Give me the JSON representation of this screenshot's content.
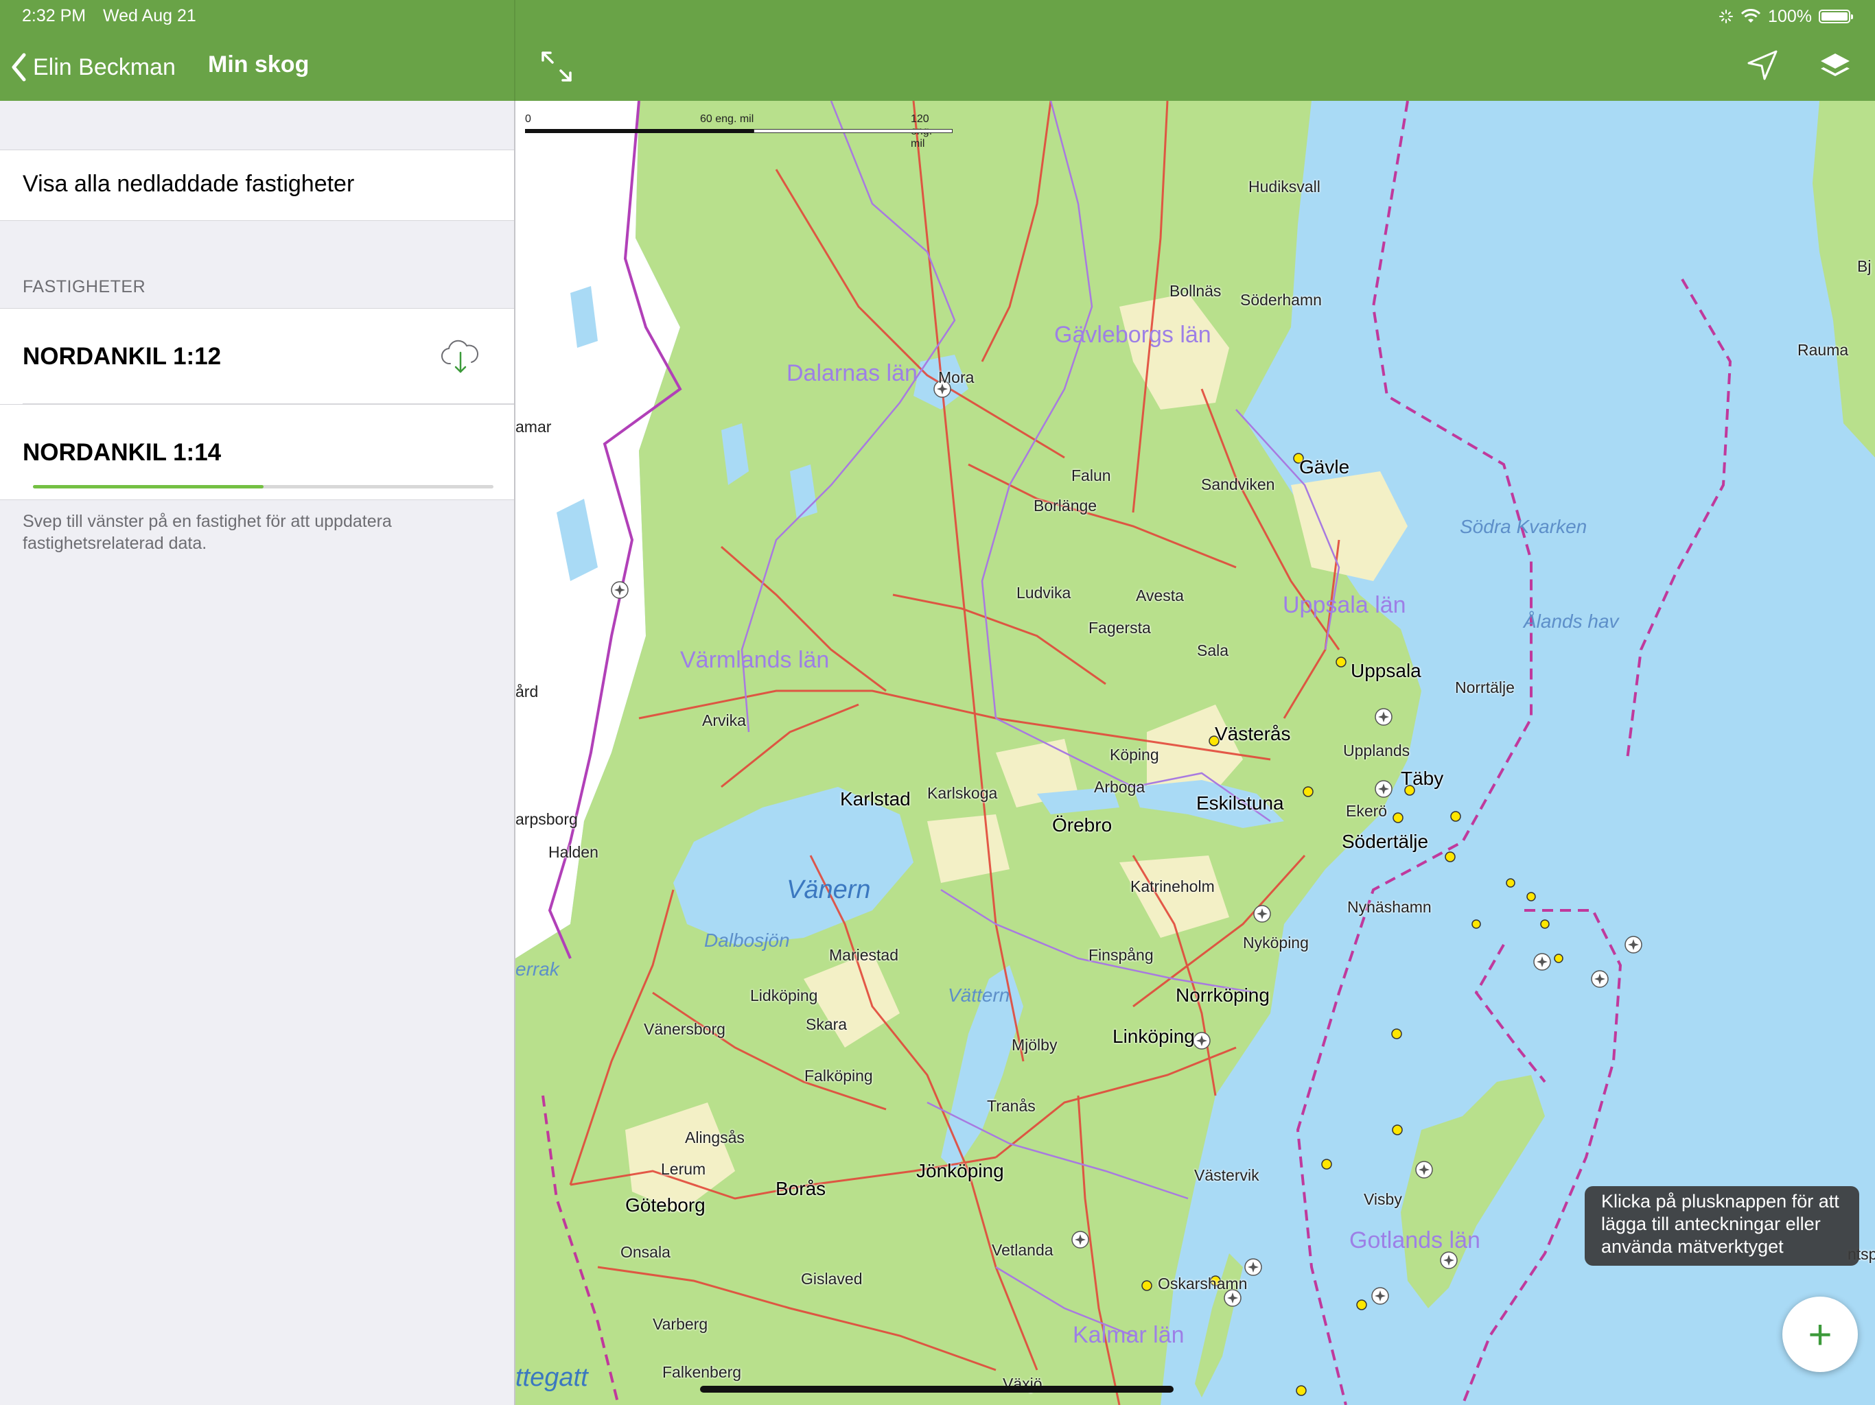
{
  "status_bar": {
    "time": "2:32 PM",
    "date": "Wed Aug 21",
    "battery": "100%"
  },
  "nav": {
    "back_label": "Elin Beckman",
    "title": "Min skog"
  },
  "sidebar": {
    "show_all_label": "Visa alla nedladdade fastigheter",
    "section_header": "FASTIGHETER",
    "properties": [
      {
        "name": "NORDANKIL 1:12",
        "status": "download-cloud-icon"
      },
      {
        "name": "NORDANKIL 1:14",
        "download_progress": 0.5
      }
    ],
    "footer_note": "Svep till vänster på en fastighet för att uppdatera fastighetsrelaterad data."
  },
  "map": {
    "scale": {
      "zero": "0",
      "mid": "60 eng. mil",
      "end": "120 eng. mil"
    },
    "regions": [
      "Gävleborgs län",
      "Dalarnas län",
      "Uppsala län",
      "Värmlands län",
      "Gotlands län",
      "Kalmar län"
    ],
    "water": [
      "Vänern",
      "Vättern",
      "Dalbosjön",
      "Södra Kvarken",
      "Ålands hav",
      "ttegatt",
      "errak"
    ],
    "places": [
      "Hudiksvall",
      "Bollnäs",
      "Söderhamn",
      "Mora",
      "Gävle",
      "Sandviken",
      "Falun",
      "Borlänge",
      "Ludvika",
      "Avesta",
      "Fagersta",
      "Sala",
      "Uppsala",
      "Norrtälje",
      "Västerås",
      "Köping",
      "Upplands",
      "Täby",
      "Arvika",
      "Karlstad",
      "Karlskoga",
      "Arboga",
      "Örebro",
      "Eskilstuna",
      "Ekerö",
      "Södertälje",
      "Katrineholm",
      "Nynäshamn",
      "Nyköping",
      "Finspång",
      "Norrköping",
      "Mariestad",
      "Lidköping",
      "Skara",
      "Mjölby",
      "Linköping",
      "Vänersborg",
      "Falköping",
      "Tranås",
      "Alingsås",
      "Lerum",
      "Borås",
      "Jönköping",
      "Göteborg",
      "Västervik",
      "Visby",
      "Onsala",
      "Vetlanda",
      "Gislaved",
      "Oskarshamn",
      "Varberg",
      "Falkenberg",
      "Växjö",
      "Halden",
      "arpsborg",
      "amar",
      "ård",
      "Rauma",
      "Bj",
      "ntspils"
    ],
    "tooltip": "Klicka på plusknappen för att lägga till anteckningar eller använda mätverktyget",
    "add_button": "+"
  }
}
